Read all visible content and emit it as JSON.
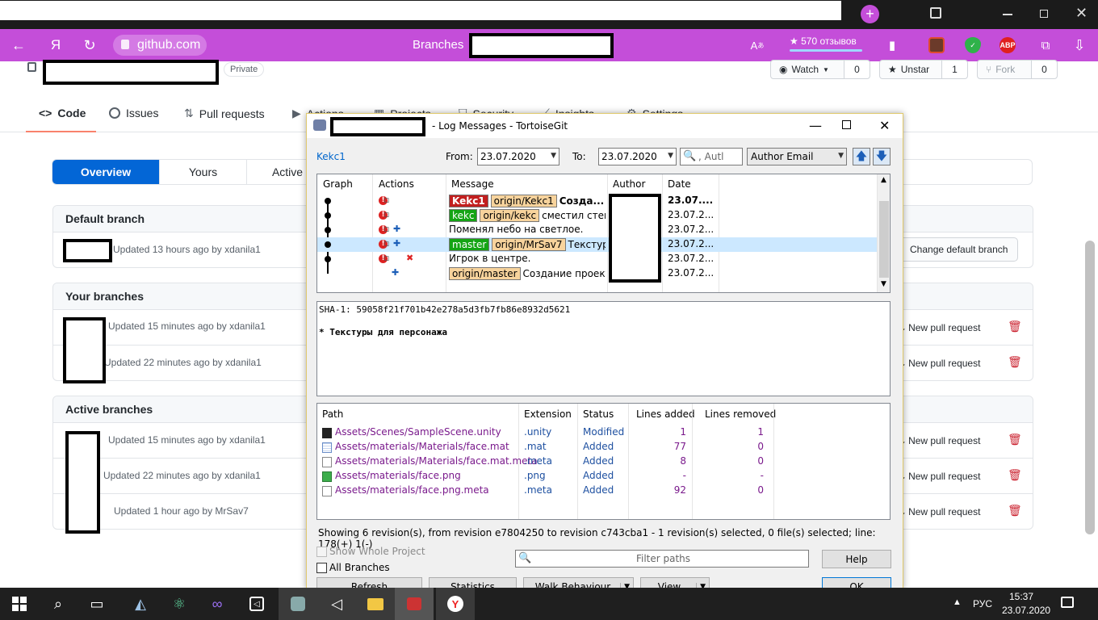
{
  "browser": {
    "url": "github.com",
    "page_title": "Branches",
    "reviews": "★ 570 отзывов",
    "ext_abp": "ABP"
  },
  "repo": {
    "private_badge": "Private",
    "watch_label": "Watch",
    "watch_count": "0",
    "unstar_label": "Unstar",
    "star_count": "1",
    "fork_label": "Fork",
    "fork_count": "0"
  },
  "nav": {
    "code": "Code",
    "issues": "Issues",
    "pulls": "Pull requests",
    "actions": "Actions",
    "projects": "Projects",
    "security": "Security",
    "insights": "Insights",
    "settings": "Settings"
  },
  "subnav": {
    "overview": "Overview",
    "yours": "Yours",
    "active": "Active"
  },
  "sections": {
    "default_title": "Default branch",
    "default_updated": "Updated 13 hours ago by xdanila1",
    "change_default": "Change default branch",
    "your_title": "Your branches",
    "your_rows": [
      "Updated 15 minutes ago by xdanila1",
      "Updated 22 minutes ago by xdanila1"
    ],
    "active_title": "Active branches",
    "active_rows": [
      "Updated 15 minutes ago by xdanila1",
      "Updated 22 minutes ago by xdanila1",
      "Updated 1 hour ago by MrSav7"
    ],
    "new_pr": "New pull request"
  },
  "tortoise": {
    "title": "- Log Messages - TortoiseGit",
    "branch": "Kekc1",
    "from_label": "From:",
    "from_value": "23.07.2020",
    "to_label": "To:",
    "to_value": "23.07.2020",
    "search_placeholder": ", Autl",
    "filter_field": "Author Email",
    "columns": {
      "graph": "Graph",
      "actions": "Actions",
      "message": "Message",
      "author": "Author",
      "date": "Date"
    },
    "rows": [
      {
        "tags": [
          {
            "t": "Kekc1",
            "c": "red"
          },
          {
            "t": "origin/Kekc1",
            "c": "orange"
          }
        ],
        "message": "Созда...",
        "date": "23.07....",
        "bold": true
      },
      {
        "tags": [
          {
            "t": "kekc",
            "c": "green"
          },
          {
            "t": "origin/kekc",
            "c": "orange"
          }
        ],
        "message": "сместил стен...",
        "date": "23.07.2..."
      },
      {
        "tags": [],
        "message": "Поменял небо на светлое.",
        "date": "23.07.2..."
      },
      {
        "tags": [
          {
            "t": "master",
            "c": "green"
          },
          {
            "t": "origin/MrSav7",
            "c": "orange"
          }
        ],
        "message": "Текстур...",
        "date": "23.07.2...",
        "selected": true
      },
      {
        "tags": [],
        "message": "Игрок в центре.",
        "date": "23.07.2..."
      },
      {
        "tags": [
          {
            "t": "origin/master",
            "c": "orange"
          }
        ],
        "message": "Создание проекта.",
        "date": "23.07.2..."
      }
    ],
    "sha_line": "SHA-1: 59058f21f701b42e278a5d3fb7fb86e8932d5621",
    "commit_msg": "* Текстуры для персонажа",
    "file_columns": {
      "path": "Path",
      "ext": "Extension",
      "status": "Status",
      "added": "Lines added",
      "removed": "Lines removed"
    },
    "files": [
      {
        "path": "Assets/Scenes/SampleScene.unity",
        "ext": ".unity",
        "status": "Modified",
        "added": "1",
        "removed": "1",
        "icon": "unity-file-icon"
      },
      {
        "path": "Assets/materials/Materials/face.mat",
        "ext": ".mat",
        "status": "Added",
        "added": "77",
        "removed": "0",
        "icon": "material-file-icon"
      },
      {
        "path": "Assets/materials/Materials/face.mat.meta",
        "ext": ".meta",
        "status": "Added",
        "added": "8",
        "removed": "0",
        "icon": "document-file-icon"
      },
      {
        "path": "Assets/materials/face.png",
        "ext": ".png",
        "status": "Added",
        "added": "-",
        "removed": "-",
        "icon": "image-file-icon"
      },
      {
        "path": "Assets/materials/face.png.meta",
        "ext": ".meta",
        "status": "Added",
        "added": "92",
        "removed": "0",
        "icon": "document-file-icon"
      }
    ],
    "status_line": "Showing 6 revision(s), from revision e7804250 to revision c743cba1 - 1 revision(s) selected, 0 file(s) selected; line: 178(+) 1(-)",
    "show_whole": "Show Whole Project",
    "all_branches": "All Branches",
    "filter_paths": "Filter paths",
    "help": "Help",
    "refresh": "Refresh",
    "statistics": "Statistics",
    "walk": "Walk Behaviour",
    "view": "View",
    "ok": "OK"
  },
  "taskbar": {
    "lang": "РУС",
    "time": "15:37",
    "date": "23.07.2020"
  },
  "colors": {
    "browser_chrome": "#c44ed9",
    "github_blue": "#0366d6",
    "tag_red": "#c21f1f",
    "tag_green": "#14a414",
    "tag_orange": "#f7d39c",
    "selection": "#cce8ff"
  }
}
